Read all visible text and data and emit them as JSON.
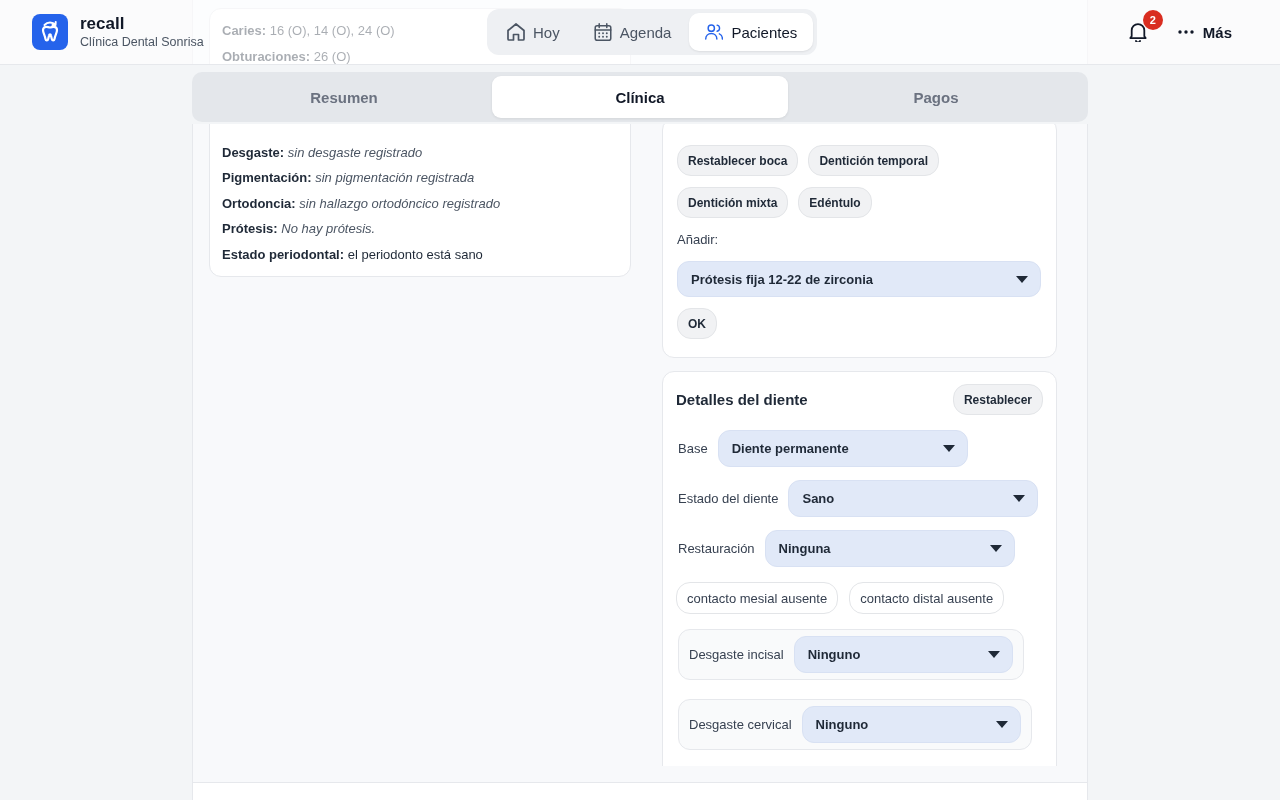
{
  "header": {
    "app_name": "recall",
    "clinic": "Clínica Dental Sonrisa",
    "nav": [
      {
        "label": "Hoy",
        "selected": false
      },
      {
        "label": "Agenda",
        "selected": false
      },
      {
        "label": "Pacientes",
        "selected": true
      }
    ],
    "notification_count": "2",
    "more_label": "Más"
  },
  "tabs": [
    {
      "label": "Resumen",
      "selected": false
    },
    {
      "label": "Clínica",
      "selected": true
    },
    {
      "label": "Pagos",
      "selected": false
    }
  ],
  "summary_card": {
    "rows_under_header": [
      {
        "label": "Caries:",
        "value": "16 (O), 14 (O), 24 (O)",
        "kind": "finding"
      },
      {
        "label": "Obturaciones:",
        "value": "26 (O)",
        "kind": "finding"
      }
    ],
    "rows": [
      {
        "label": "Desgaste:",
        "value": "sin desgaste registrado",
        "kind": "none"
      },
      {
        "label": "Pigmentación:",
        "value": "sin pigmentación registrada",
        "kind": "none"
      },
      {
        "label": "Ortodoncia:",
        "value": "sin hallazgo ortodóncico registrado",
        "kind": "none"
      },
      {
        "label": "Prótesis:",
        "value": "No hay prótesis.",
        "kind": "none"
      },
      {
        "label": "Estado periodontal:",
        "value": "el periodonto está sano",
        "kind": "finding"
      }
    ]
  },
  "mouth_card": {
    "actions": [
      "Restablecer boca",
      "Dentición temporal",
      "Dentición mixta",
      "Edéntulo"
    ],
    "add_label": "Añadir:",
    "add_select": "Prótesis fija 12-22 de zirconia",
    "ok_button": "OK"
  },
  "tooth_card": {
    "title": "Detalles del diente",
    "reset_button": "Restablecer",
    "fields": [
      {
        "label": "Base",
        "value": "Diente permanente"
      },
      {
        "label": "Estado del diente",
        "value": "Sano"
      },
      {
        "label": "Restauración",
        "value": "Ninguna"
      }
    ],
    "toggles": [
      {
        "label": "contacto mesial ausente",
        "checked": false
      },
      {
        "label": "contacto distal ausente",
        "checked": false
      }
    ],
    "wear": [
      {
        "label": "Desgaste incisal",
        "value": "Ninguno"
      },
      {
        "label": "Desgaste cervical",
        "value": "Ninguno"
      }
    ]
  }
}
